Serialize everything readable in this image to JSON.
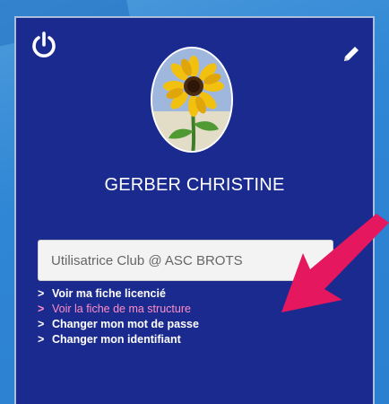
{
  "profile": {
    "name": "GERBER CHRISTINE",
    "role": "Utilisatrice Club @ ASC BROTS"
  },
  "icons": {
    "power": "power-icon",
    "edit": "pencil-icon",
    "avatar": "sunflower-photo",
    "chevron": "chevron-right-icon",
    "annotation": "arrow-annotation-icon"
  },
  "links": [
    {
      "label": "Voir ma fiche licencié"
    },
    {
      "label": "Voir la fiche de ma structure"
    },
    {
      "label": "Changer mon mot de passe"
    },
    {
      "label": "Changer mon identifiant"
    }
  ],
  "colors": {
    "card_bg": "#1b2a8f",
    "highlight_link": "#ff8ec5",
    "annotation_arrow": "#e5175f",
    "page_bg": "#2f86d4"
  }
}
